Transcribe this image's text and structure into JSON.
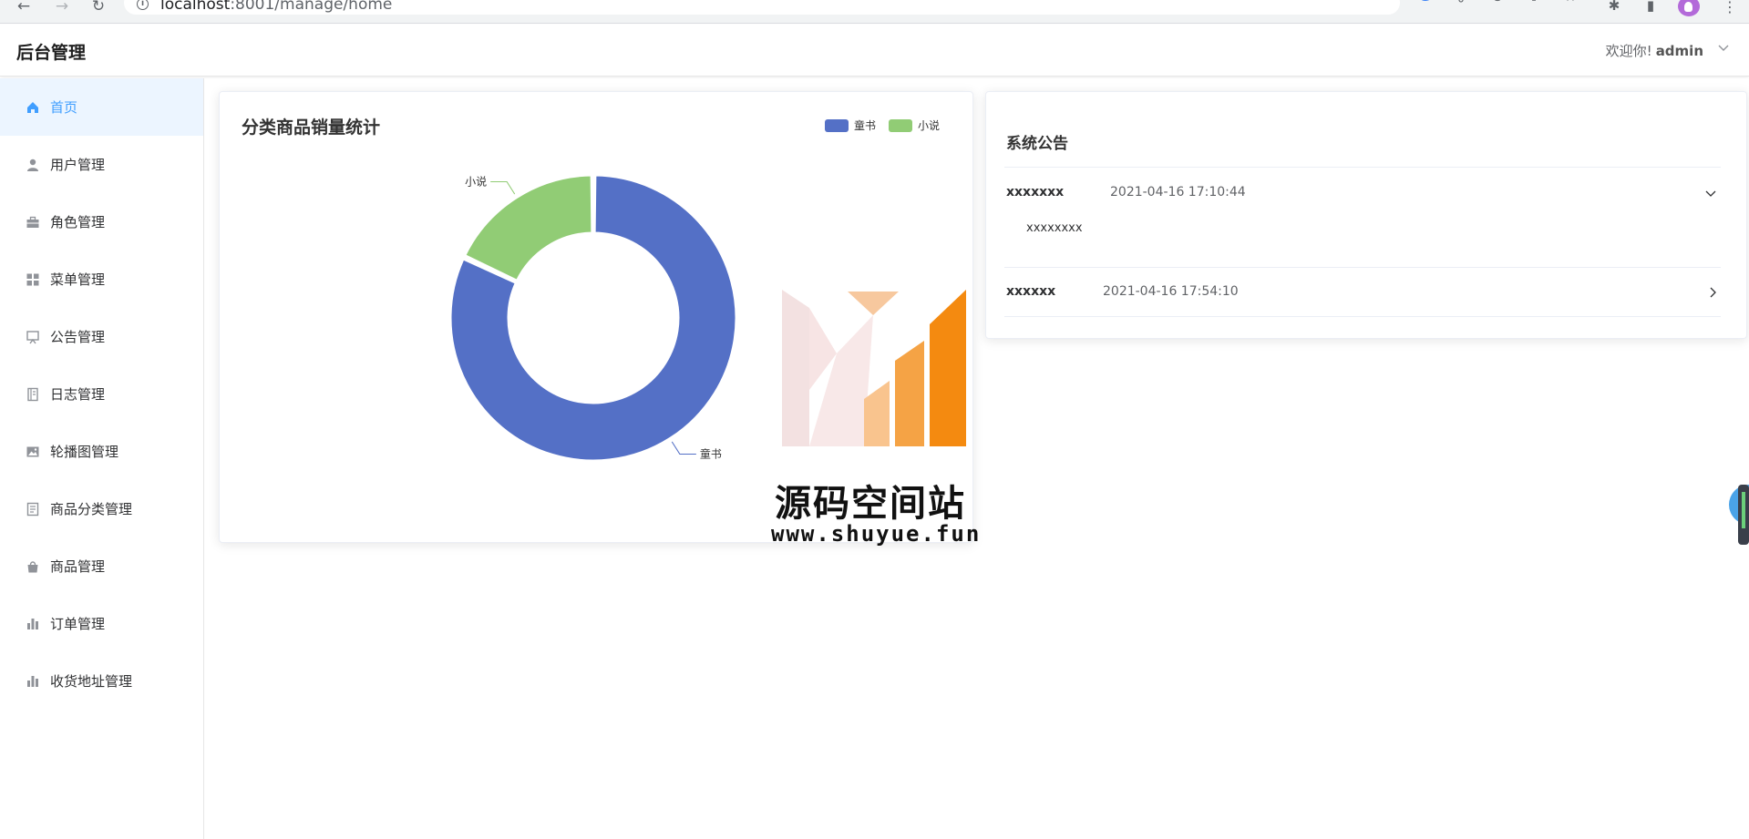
{
  "browser": {
    "url_host": "localhost",
    "url_path": ":8001/manage/home",
    "back_icon": "arrow-left-icon",
    "forward_icon": "arrow-right-icon",
    "reload_icon": "reload-icon"
  },
  "header": {
    "brand": "后台管理",
    "welcome": "欢迎你!",
    "username": "admin"
  },
  "sidebar": {
    "items": [
      {
        "label": "首页",
        "icon": "home-icon",
        "active": true
      },
      {
        "label": "用户管理",
        "icon": "user-icon"
      },
      {
        "label": "角色管理",
        "icon": "briefcase-icon"
      },
      {
        "label": "菜单管理",
        "icon": "grid-icon"
      },
      {
        "label": "公告管理",
        "icon": "board-icon"
      },
      {
        "label": "日志管理",
        "icon": "notebook-icon"
      },
      {
        "label": "轮播图管理",
        "icon": "picture-icon"
      },
      {
        "label": "商品分类管理",
        "icon": "document-icon"
      },
      {
        "label": "商品管理",
        "icon": "bag-icon"
      },
      {
        "label": "订单管理",
        "icon": "bar-chart-icon"
      },
      {
        "label": "收货地址管理",
        "icon": "bar-chart-icon"
      }
    ]
  },
  "chart_card": {
    "title": "分类商品销量统计"
  },
  "chart_data": {
    "type": "pie",
    "title": "分类商品销量统计",
    "donut": true,
    "legend_position": "top-right",
    "categories": [
      "童书",
      "小说"
    ],
    "values": [
      82,
      18
    ],
    "colors": [
      "#5470c6",
      "#91cc75"
    ]
  },
  "notice": {
    "title": "系统公告",
    "items": [
      {
        "title": "xxxxxxx",
        "time": "2021-04-16 17:10:44",
        "body": "xxxxxxxx",
        "expanded": true
      },
      {
        "title": "xxxxxx",
        "time": "2021-04-16 17:54:10",
        "body": "",
        "expanded": false
      }
    ]
  },
  "watermark": {
    "name": "源码空间站",
    "url": "www.shuyue.fun"
  }
}
